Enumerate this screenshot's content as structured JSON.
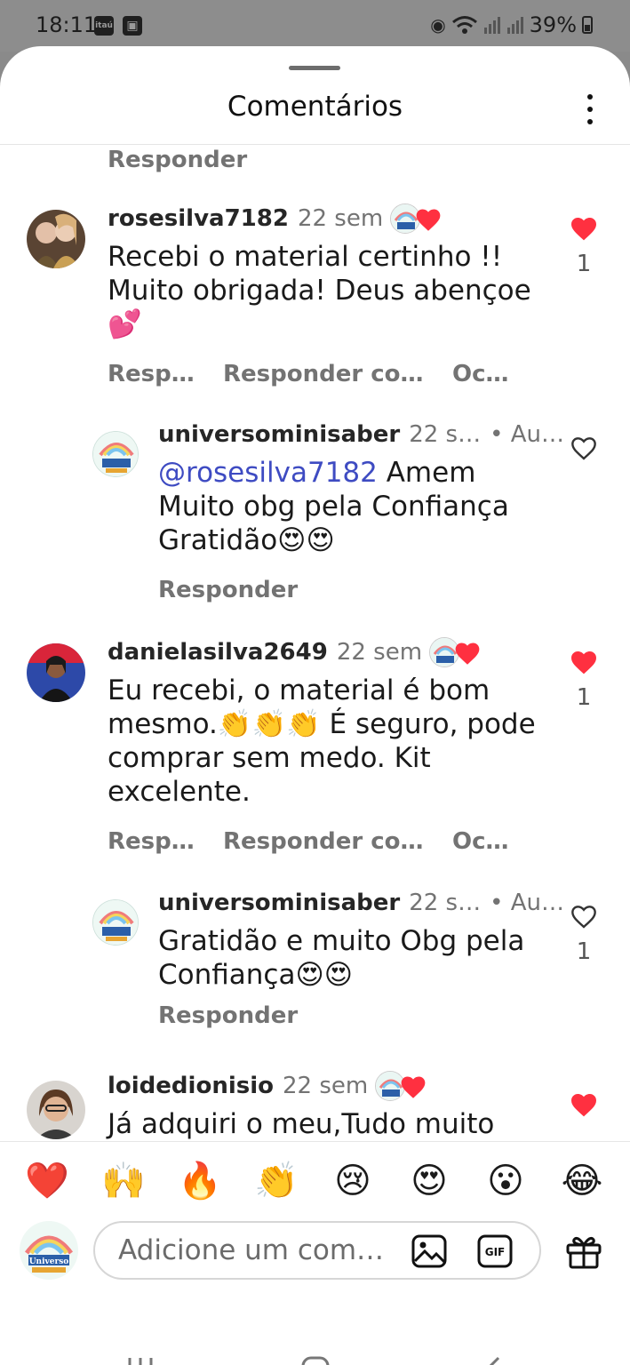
{
  "status_bar": {
    "time": "18:11",
    "carrier_icon_label": "itaú",
    "battery": "39%"
  },
  "sheet": {
    "title": "Comentários"
  },
  "top_reply": "Responder",
  "comments": [
    {
      "username": "rosesilva7182",
      "time": "22 sem",
      "text": "Recebi o material  certinho !! Muito obrigada! Deus abençoe 💕",
      "actions": [
        "Resp…",
        "Responder co…",
        "Oc…"
      ],
      "liked": true,
      "likes": "1"
    },
    {
      "username": "universominisaber",
      "time": "22 s…",
      "author_tag": "• Au…",
      "mention": "@rosesilva7182",
      "text": " Amem Muito obg pela Confiança Gratidão😍😍",
      "actions": [
        "Responder"
      ],
      "liked": false,
      "likes": ""
    },
    {
      "username": "danielasilva2649",
      "time": "22 sem",
      "text": "Eu recebi, o material é bom mesmo.👏👏👏 É seguro, pode comprar sem medo. Kit excelente.",
      "actions": [
        "Resp…",
        "Responder co…",
        "Oc…"
      ],
      "liked": true,
      "likes": "1"
    },
    {
      "username": "universominisaber",
      "time": "22 s…",
      "author_tag": "• Au…",
      "text": "Gratidão e muito Obg pela Confiança😍😍",
      "actions": [
        "Responder"
      ],
      "liked": false,
      "likes": "1"
    },
    {
      "username": "loidedionisio",
      "time": "22 sem",
      "text": "Já adquiri o meu,Tudo muito",
      "liked": true,
      "likes": ""
    }
  ],
  "emoji_bar": [
    "❤️",
    "🙌",
    "🔥",
    "👏",
    "😢",
    "😍",
    "😮",
    "😂"
  ],
  "input": {
    "placeholder": "Adicione um com…"
  },
  "brand": {
    "logo_text": "Universo",
    "heart_color": "#ff3040",
    "mention_color": "#3e4bc2"
  },
  "icons": [
    "more-vertical-icon",
    "heart-icon",
    "image-icon",
    "gif-icon",
    "gift-icon",
    "recent-apps-icon",
    "home-icon",
    "back-icon"
  ]
}
